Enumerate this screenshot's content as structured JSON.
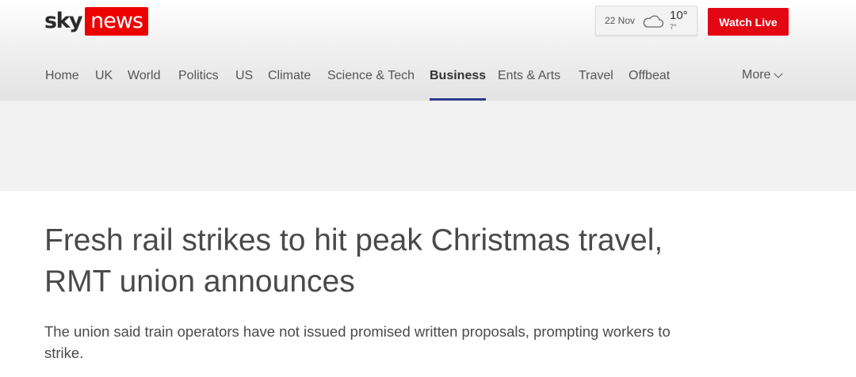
{
  "header": {
    "logo": {
      "sky": "sky",
      "news": "news"
    },
    "weather": {
      "date": "22 Nov",
      "icon": "cloud-icon",
      "high": "10°",
      "low": "7°"
    },
    "watch_live_label": "Watch Live",
    "brand_red": "#e30613"
  },
  "nav": {
    "items": [
      {
        "label": "Home"
      },
      {
        "label": "UK"
      },
      {
        "label": "World"
      },
      {
        "label": "Politics"
      },
      {
        "label": "US"
      },
      {
        "label": "Climate"
      },
      {
        "label": "Science & Tech"
      },
      {
        "label": "Business",
        "active": true
      },
      {
        "label": "Ents & Arts"
      },
      {
        "label": "Travel"
      },
      {
        "label": "Offbeat"
      }
    ],
    "more_label": "More",
    "active_underline_color": "#2f3a8f"
  },
  "article": {
    "headline": "Fresh rail strikes to hit peak Christmas travel, RMT union announces",
    "standfirst": "The union said train operators have not issued promised written proposals, prompting workers to strike."
  }
}
